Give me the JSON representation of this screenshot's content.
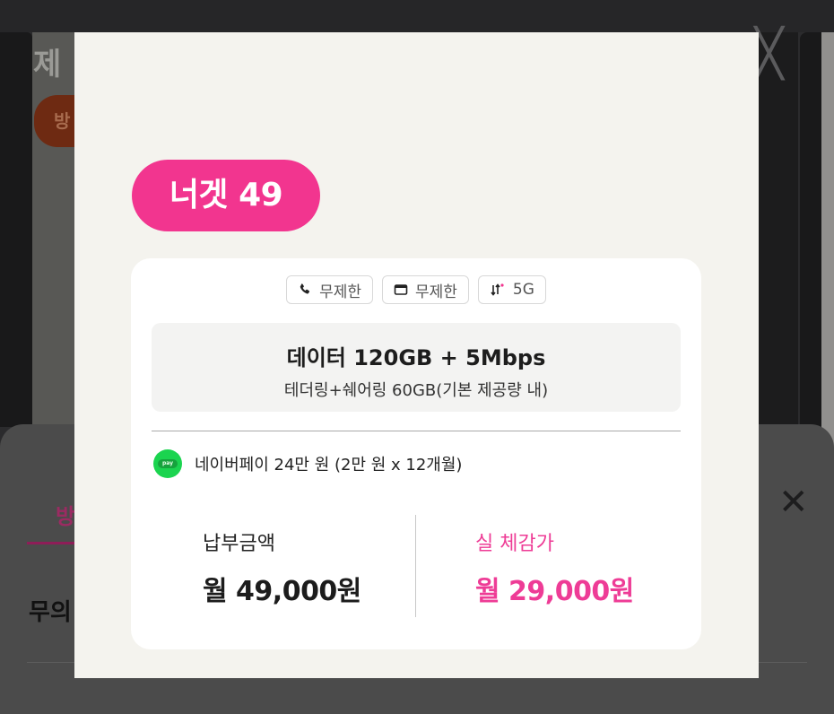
{
  "background": {
    "left_title": "제",
    "left_chip": "방",
    "right_close_glyph": "╳",
    "sheet": {
      "tab_label": "방",
      "close_glyph": "✕",
      "heading": "무의"
    }
  },
  "card": {
    "plan_name": "너겟 49",
    "chips": [
      {
        "icon": "phone-icon",
        "label": "무제한"
      },
      {
        "icon": "message-icon",
        "label": "무제한"
      },
      {
        "icon": "data-transfer-icon",
        "label": "5G"
      }
    ],
    "data": {
      "main": "데이터 120GB + 5Mbps",
      "sub": "테더링+쉐어링 60GB(기본 제공량 내)"
    },
    "benefit": {
      "icon": "naver-pay-icon",
      "icon_text": "pay",
      "text": "네이버페이 24만 원 (2만 원 x 12개월)"
    },
    "price": {
      "payment_label": "납부금액",
      "payment_value": "월 49,000원",
      "effective_label": "실 체감가",
      "effective_value": "월 29,000원"
    }
  },
  "colors": {
    "accent_pink": "#f2358f",
    "price_pink": "#ee3c96",
    "npay_green": "#1bd44f"
  }
}
